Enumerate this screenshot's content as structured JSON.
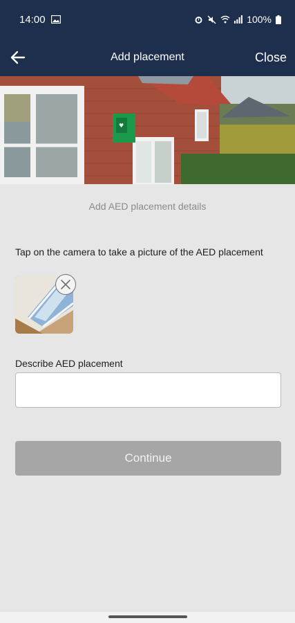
{
  "status_bar": {
    "time": "14:00",
    "battery": "100%",
    "icons": [
      "image-icon",
      "alarm-icon",
      "mute-icon",
      "wifi-icon",
      "signal-icon",
      "battery-icon"
    ]
  },
  "app_bar": {
    "title": "Add placement",
    "close_label": "Close",
    "back_icon": "arrow-left-icon"
  },
  "main": {
    "subtitle": "Add AED placement details",
    "instruction": "Tap on the camera to take a picture of the AED placement",
    "field_label": "Describe AED placement",
    "field_value": "",
    "field_placeholder": "",
    "continue_label": "Continue"
  },
  "colors": {
    "header": "#1e2f4d",
    "background": "#e6e6e6",
    "button_disabled": "#a6a6a6"
  }
}
